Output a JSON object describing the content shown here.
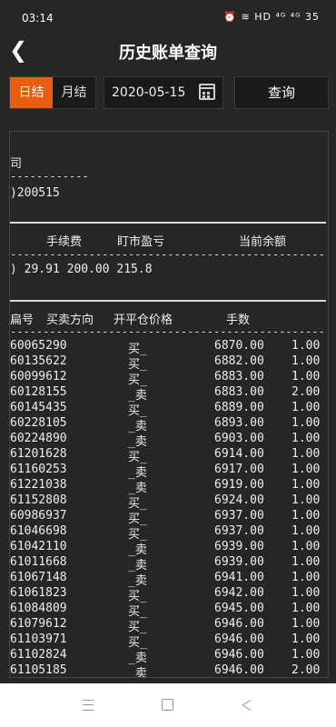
{
  "status": {
    "time": "03:14",
    "icons": "⏰ ≋ HD ⁴ᴳ ⁴ᴳ 35"
  },
  "header": {
    "title": "历史账单查询"
  },
  "toolbar": {
    "daily": "日结",
    "monthly": "月结",
    "date": "2020-05-15",
    "query": "查询"
  },
  "statement": {
    "company_fragment": "司",
    "date_fragment": ")200515",
    "fee_header": "手续费",
    "mtm_header": "盯市盈亏",
    "balance_header": "当前余额",
    "values_line": ")         29.91      200.00          215.8",
    "trade_headers": {
      "id": "扁号",
      "direction": "买卖方向",
      "price": "开平仓价格",
      "lots": "手数"
    },
    "trades": [
      {
        "id": "60065290",
        "dir": "买_",
        "price": "6870.00",
        "lots": "1.00"
      },
      {
        "id": "60135622",
        "dir": "买_",
        "price": "6882.00",
        "lots": "1.00"
      },
      {
        "id": "60099612",
        "dir": "买_",
        "price": "6883.00",
        "lots": "1.00"
      },
      {
        "id": "60128155",
        "dir": "_卖",
        "price": "6883.00",
        "lots": "2.00"
      },
      {
        "id": "60145435",
        "dir": "买_",
        "price": "6889.00",
        "lots": "1.00"
      },
      {
        "id": "60228105",
        "dir": "_卖",
        "price": "6893.00",
        "lots": "1.00"
      },
      {
        "id": "60224890",
        "dir": "_卖",
        "price": "6903.00",
        "lots": "1.00"
      },
      {
        "id": "61201628",
        "dir": "买_",
        "price": "6914.00",
        "lots": "1.00"
      },
      {
        "id": "61160253",
        "dir": "_卖",
        "price": "6917.00",
        "lots": "1.00"
      },
      {
        "id": "61221038",
        "dir": "_卖",
        "price": "6919.00",
        "lots": "1.00"
      },
      {
        "id": "61152808",
        "dir": "买_",
        "price": "6924.00",
        "lots": "1.00"
      },
      {
        "id": "60986937",
        "dir": "买_",
        "price": "6937.00",
        "lots": "1.00"
      },
      {
        "id": "61046698",
        "dir": "买_",
        "price": "6937.00",
        "lots": "1.00"
      },
      {
        "id": "61042110",
        "dir": "_卖",
        "price": "6939.00",
        "lots": "1.00"
      },
      {
        "id": "61011668",
        "dir": "_卖",
        "price": "6939.00",
        "lots": "1.00"
      },
      {
        "id": "61067148",
        "dir": "_卖",
        "price": "6941.00",
        "lots": "1.00"
      },
      {
        "id": "61061823",
        "dir": "买_",
        "price": "6942.00",
        "lots": "1.00"
      },
      {
        "id": "61084809",
        "dir": "买_",
        "price": "6945.00",
        "lots": "1.00"
      },
      {
        "id": "61079612",
        "dir": "买_",
        "price": "6946.00",
        "lots": "1.00"
      },
      {
        "id": "61103971",
        "dir": "买_",
        "price": "6946.00",
        "lots": "1.00"
      },
      {
        "id": "61102824",
        "dir": "_卖",
        "price": "6946.00",
        "lots": "1.00"
      },
      {
        "id": "61105185",
        "dir": "_卖",
        "price": "6946.00",
        "lots": "2.00"
      }
    ]
  },
  "colors": {
    "accent": "#e85d10",
    "background": "#262626"
  }
}
